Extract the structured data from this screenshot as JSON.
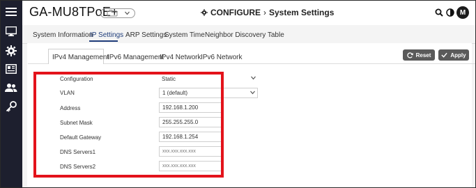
{
  "header": {
    "device_name": "GA-MU8TPoE+",
    "breadcrumb_section": "CONFIGURE",
    "breadcrumb_page": "System Settings",
    "avatar_initial": "M"
  },
  "sidebar": {
    "items": [
      {
        "icon": "menu-icon"
      },
      {
        "icon": "monitor-icon"
      },
      {
        "icon": "gear-icon"
      },
      {
        "icon": "newspaper-icon"
      },
      {
        "icon": "users-icon"
      },
      {
        "icon": "key-icon"
      }
    ]
  },
  "top_tabs": [
    {
      "label": "System Information"
    },
    {
      "label": "IP Settings"
    },
    {
      "label": "ARP Settings"
    },
    {
      "label": "System Time"
    },
    {
      "label": "Neighbor Discovery Table"
    }
  ],
  "sub_tabs": [
    {
      "label": "IPv4 Management"
    },
    {
      "label": "IPv6 Management"
    },
    {
      "label": "IPv4 Network"
    },
    {
      "label": "IPv6 Network"
    }
  ],
  "buttons": {
    "reset": "Reset",
    "apply": "Apply"
  },
  "form": {
    "configuration": {
      "label": "Configuration",
      "value": "Static"
    },
    "vlan": {
      "label": "VLAN",
      "value": "1 (default)"
    },
    "address": {
      "label": "Address",
      "value": "192.168.1.200"
    },
    "subnet_mask": {
      "label": "Subnet Mask",
      "value": "255.255.255.0"
    },
    "default_gateway": {
      "label": "Default Gateway",
      "value": "192.168.1.254"
    },
    "dns1": {
      "label": "DNS Servers1",
      "placeholder": "xxx.xxx.xxx.xxx"
    },
    "dns2": {
      "label": "DNS Servers2",
      "placeholder": "xxx.xxx.xxx.xxx"
    }
  },
  "colors": {
    "sidebar_bg": "#1d1f2e",
    "active_tab": "#1f3d7a",
    "highlight": "#e3131b",
    "button_bg": "#5a5a5a"
  }
}
